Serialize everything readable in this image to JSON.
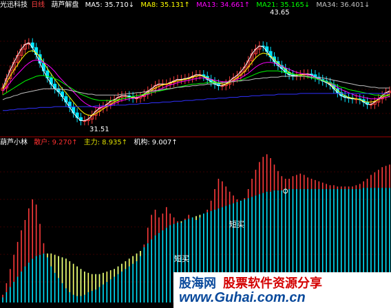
{
  "header_top": {
    "app_title": "光迅科技",
    "period": "日线",
    "indicator": "葫芦解盘",
    "ma": [
      {
        "label": "MA5:",
        "value": "35.710",
        "arrow": "↓",
        "color": "#ffffff"
      },
      {
        "label": "MA8:",
        "value": "35.131",
        "arrow": "↑",
        "color": "#ffff00"
      },
      {
        "label": "MA13:",
        "value": "34.661",
        "arrow": "↑",
        "color": "#ff00ff"
      },
      {
        "label": "MA21:",
        "value": "35.165",
        "arrow": "↓",
        "color": "#00ff00"
      },
      {
        "label": "MA34:",
        "value": "36.401",
        "arrow": "↓",
        "color": "#c0c0c0"
      }
    ]
  },
  "header_bottom": {
    "title": "葫芦小林",
    "items": [
      {
        "label": "散户:",
        "value": "9.270",
        "arrow": "↑",
        "color": "#ff3030"
      },
      {
        "label": "主力:",
        "value": "8.935",
        "arrow": "↑",
        "color": "#e0e000"
      },
      {
        "label": "机构:",
        "value": "9.007",
        "arrow": "↑",
        "color": "#ffffff"
      }
    ]
  },
  "annotations": {
    "high": "43.65",
    "low": "31.51",
    "signal_1": "短买",
    "signal_2": "短买"
  },
  "watermark": {
    "line1a": "股海网",
    "line1b": "股票软件资源分享",
    "line2": "www.Guhai.com.cn"
  },
  "colors": {
    "up": "#ff3b3b",
    "down": "#00e5ff",
    "bg": "#000000",
    "zero_cross": "#ffff66"
  },
  "chart_data": [
    {
      "type": "candlestick",
      "title": "葫芦解盘",
      "ylim": [
        30,
        46
      ],
      "annotations": [
        {
          "text": "43.65",
          "kind": "high"
        },
        {
          "text": "31.51",
          "kind": "low"
        }
      ],
      "series": [
        {
          "name": "MA5",
          "values": [
            36.1,
            37.3,
            38.4,
            39.4,
            40.3,
            41.1,
            41.7,
            41.9,
            41.3,
            40.4,
            39.3,
            38.3,
            37.4,
            36.6,
            36,
            35.6,
            35,
            34.3,
            33.6,
            32.9,
            32.3,
            31.9,
            31.9,
            32.1,
            32.6,
            33.1,
            33.5,
            33.7,
            34,
            34.4,
            34.6,
            34.9,
            35.1,
            35.1,
            35,
            34.8,
            34.8,
            35,
            35.3,
            35.7,
            36,
            36.4,
            36.6,
            36.6,
            36.6,
            36.8,
            37,
            37.2,
            37.2,
            37.3,
            37.4,
            37.6,
            37.8,
            37.8,
            37.6,
            37.2,
            36.9,
            36.6,
            36.4,
            36.4,
            36.6,
            37,
            37.4,
            37.7,
            38.2,
            38.8,
            39.6,
            40.5,
            41.1,
            41.5,
            41.4,
            40.8,
            40.1,
            39.5,
            39,
            38.6,
            38.1,
            37.8,
            37.7,
            37.7,
            37.8,
            37.9,
            37.9,
            37.8,
            37.5,
            37.2,
            37,
            36.8,
            36.5,
            36,
            35.5,
            35.1,
            34.9,
            34.8,
            34.7,
            34.7,
            34.6,
            34.3,
            34,
            34,
            34.3,
            34.7,
            35.1,
            35.5,
            35.7
          ]
        },
        {
          "name": "MA8",
          "values": [
            35.9,
            36.8,
            37.6,
            38.4,
            39.1,
            39.8,
            40.4,
            40.8,
            40.9,
            40.6,
            40.1,
            39.4,
            38.6,
            37.9,
            37.2,
            36.6,
            36,
            35.5,
            34.9,
            34.3,
            33.7,
            33.2,
            32.8,
            32.6,
            32.6,
            32.8,
            33.1,
            33.4,
            33.7,
            34,
            34.3,
            34.5,
            34.7,
            34.8,
            34.9,
            34.9,
            34.9,
            35,
            35.2,
            35.5,
            35.8,
            36.1,
            36.3,
            36.5,
            36.6,
            36.7,
            36.9,
            37,
            37.1,
            37.2,
            37.3,
            37.5,
            37.6,
            37.7,
            37.6,
            37.4,
            37.2,
            36.9,
            36.7,
            36.6,
            36.6,
            36.8,
            37.1,
            37.4,
            37.8,
            38.2,
            38.8,
            39.4,
            40,
            40.4,
            40.6,
            40.5,
            40.2,
            39.8,
            39.3,
            38.9,
            38.5,
            38.1,
            37.9,
            37.8,
            37.8,
            37.8,
            37.8,
            37.7,
            37.5,
            37.3,
            37.1,
            36.9,
            36.6,
            36.2,
            35.8,
            35.4,
            35.1,
            34.9,
            34.8,
            34.7,
            34.6,
            34.4,
            34.3,
            34.3,
            34.4,
            34.6,
            34.9,
            35.1,
            35.3
          ]
        },
        {
          "name": "MA13",
          "values": [
            35.7,
            36.2,
            36.8,
            37.4,
            37.9,
            38.4,
            38.9,
            39.3,
            39.6,
            39.7,
            39.6,
            39.4,
            39.1,
            38.7,
            38.2,
            37.6,
            37.1,
            36.6,
            36.1,
            35.6,
            35.1,
            34.6,
            34.2,
            33.9,
            33.7,
            33.6,
            33.6,
            33.7,
            33.8,
            33.9,
            34.1,
            34.3,
            34.5,
            34.6,
            34.7,
            34.8,
            34.9,
            35,
            35.1,
            35.3,
            35.5,
            35.7,
            35.9,
            36.1,
            36.3,
            36.5,
            36.6,
            36.8,
            36.9,
            37,
            37.1,
            37.2,
            37.3,
            37.4,
            37.4,
            37.3,
            37.2,
            37.1,
            37,
            36.9,
            36.9,
            36.9,
            37,
            37.2,
            37.4,
            37.7,
            38,
            38.4,
            38.8,
            39.1,
            39.3,
            39.4,
            39.4,
            39.3,
            39.1,
            38.9,
            38.7,
            38.5,
            38.3,
            38.1,
            38,
            37.9,
            37.8,
            37.7,
            37.5,
            37.3,
            37.1,
            36.9,
            36.7,
            36.5,
            36.2,
            35.9,
            35.7,
            35.5,
            35.3,
            35.1,
            35,
            34.9,
            34.8,
            34.7,
            34.7,
            34.7,
            34.8,
            34.9,
            35
          ]
        },
        {
          "name": "MA21",
          "values": [
            35.2,
            35.5,
            35.8,
            36.1,
            36.4,
            36.7,
            37,
            37.2,
            37.4,
            37.6,
            37.7,
            37.7,
            37.6,
            37.5,
            37.3,
            37.1,
            36.8,
            36.5,
            36.2,
            35.9,
            35.6,
            35.3,
            35.1,
            34.9,
            34.7,
            34.6,
            34.5,
            34.5,
            34.5,
            34.5,
            34.5,
            34.6,
            34.7,
            34.8,
            34.9,
            35,
            35.1,
            35.2,
            35.3,
            35.4,
            35.5,
            35.6,
            35.7,
            35.8,
            35.9,
            36,
            36.1,
            36.2,
            36.3,
            36.4,
            36.5,
            36.6,
            36.6,
            36.7,
            36.7,
            36.8,
            36.8,
            36.8,
            36.8,
            36.8,
            36.8,
            36.9,
            36.9,
            37,
            37.1,
            37.3,
            37.5,
            37.7,
            37.9,
            38.1,
            38.2,
            38.3,
            38.3,
            38.3,
            38.3,
            38.2,
            38.1,
            38,
            37.9,
            37.8,
            37.7,
            37.6,
            37.5,
            37.4,
            37.3,
            37.2,
            37.1,
            36.9,
            36.8,
            36.6,
            36.4,
            36.2,
            36.1,
            35.9,
            35.8,
            35.7,
            35.6,
            35.5,
            35.4,
            35.3,
            35.2,
            35.2,
            35.1,
            35.1,
            35.1
          ]
        },
        {
          "name": "MA34",
          "values": [
            34.6,
            34.8,
            34.9,
            35.1,
            35.2,
            35.4,
            35.5,
            35.6,
            35.7,
            35.8,
            35.9,
            36,
            36,
            36,
            36,
            36,
            35.9,
            35.9,
            35.8,
            35.7,
            35.6,
            35.5,
            35.4,
            35.3,
            35.3,
            35.2,
            35.2,
            35.2,
            35.2,
            35.2,
            35.2,
            35.2,
            35.3,
            35.3,
            35.4,
            35.4,
            35.5,
            35.5,
            35.6,
            35.6,
            35.7,
            35.8,
            35.8,
            35.9,
            36,
            36,
            36.1,
            36.2,
            36.2,
            36.3,
            36.3,
            36.4,
            36.4,
            36.5,
            36.5,
            36.6,
            36.6,
            36.7,
            36.7,
            36.8,
            36.8,
            36.9,
            36.9,
            37,
            37,
            37.1,
            37.1,
            37.2,
            37.3,
            37.3,
            37.4,
            37.4,
            37.5,
            37.5,
            37.5,
            37.6,
            37.6,
            37.6,
            37.6,
            37.6,
            37.6,
            37.6,
            37.6,
            37.5,
            37.5,
            37.4,
            37.4,
            37.3,
            37.2,
            37.1,
            37,
            36.9,
            36.8,
            36.7,
            36.6,
            36.5,
            36.4,
            36.4,
            36.3,
            36.2,
            36.2,
            36.1,
            36.1,
            36.1,
            36.1
          ]
        },
        {
          "name": "MA60",
          "values": [
            33.2,
            33.2,
            33.3,
            33.3,
            33.4,
            33.4,
            33.4,
            33.5,
            33.5,
            33.5,
            33.6,
            33.6,
            33.6,
            33.6,
            33.7,
            33.7,
            33.7,
            33.7,
            33.7,
            33.7,
            33.7,
            33.7,
            33.7,
            33.7,
            33.7,
            33.8,
            33.8,
            33.8,
            33.8,
            33.8,
            33.9,
            33.9,
            33.9,
            33.9,
            34,
            34,
            34,
            34.1,
            34.1,
            34.1,
            34.2,
            34.2,
            34.2,
            34.3,
            34.3,
            34.3,
            34.4,
            34.4,
            34.4,
            34.5,
            34.5,
            34.5,
            34.6,
            34.6,
            34.6,
            34.7,
            34.7,
            34.7,
            34.8,
            34.8,
            34.8,
            34.9,
            34.9,
            34.9,
            35,
            35,
            35,
            35.1,
            35.1,
            35.1,
            35.2,
            35.2,
            35.2,
            35.2,
            35.3,
            35.3,
            35.3,
            35.3,
            35.3,
            35.3,
            35.4,
            35.4,
            35.4,
            35.4,
            35.4,
            35.4,
            35.4,
            35.4,
            35.4,
            35.4,
            35.4,
            35.4,
            35.4,
            35.4,
            35.4,
            35.4,
            35.4,
            35.4,
            35.4,
            35.4,
            35.4,
            35.4,
            35.4,
            35.4,
            35.4
          ]
        }
      ]
    },
    {
      "type": "bar",
      "title": "葫芦小林",
      "ylim": [
        0,
        12
      ],
      "annotations": [
        {
          "text": "短买",
          "index": 39
        },
        {
          "text": "短买",
          "index": 84
        }
      ],
      "series": [
        {
          "name": "散户",
          "values": [
            0.6,
            1.5,
            2.6,
            3.7,
            4.7,
            5.6,
            6.4,
            7.3,
            8,
            7.6,
            6.1,
            4.6,
            3.5,
            2.8,
            2.3,
            1.9,
            1.5,
            1.1,
            0.8,
            0.6,
            0.5,
            0.5,
            0.6,
            0.8,
            0.9,
            1,
            1.2,
            1.4,
            1.6,
            1.8,
            2,
            2.2,
            2.4,
            2.6,
            2.8,
            3,
            3.2,
            3.6,
            4.5,
            5.8,
            6.8,
            7.2,
            6.6,
            6.9,
            7.4,
            6.9,
            6.6,
            6.3,
            6.2,
            6.5,
            6.8,
            6.6,
            6.4,
            6.6,
            6.9,
            7.2,
            7.9,
            8.8,
            9.6,
            9.4,
            9,
            8.6,
            8.3,
            8,
            7.9,
            8.1,
            8.8,
            9.6,
            10.3,
            10.9,
            11.3,
            11.5,
            11.2,
            10.7,
            10.2,
            9.8,
            9.6,
            9.6,
            9.8,
            9.9,
            10,
            9.9,
            9.7,
            9.6,
            9.5,
            9.4,
            9.3,
            9.2,
            9.1,
            9.1,
            9,
            9,
            9,
            9,
            9,
            9.1,
            9.2,
            9.4,
            9.6,
            9.9,
            10.1,
            10.3,
            10.5,
            10.6,
            10.7
          ]
        },
        {
          "name": "主力",
          "values": [
            0.4,
            0.8,
            1.2,
            1.6,
            2,
            2.4,
            2.8,
            3.1,
            3.4,
            3.6,
            3.7,
            3.8,
            3.8,
            3.8,
            3.7,
            3.6,
            3.5,
            3.4,
            3.2,
            3,
            2.8,
            2.6,
            2.4,
            2.3,
            2.2,
            2.2,
            2.2,
            2.3,
            2.4,
            2.5,
            2.6,
            2.8,
            3,
            3.2,
            3.4,
            3.6,
            3.8,
            4,
            4.3,
            4.6,
            4.9,
            5.2,
            5.4,
            5.6,
            5.8,
            6,
            6.1,
            6.2,
            6.3,
            6.4,
            6.5,
            6.6,
            6.7,
            6.8,
            6.9,
            7,
            7.1,
            7.2,
            7.3,
            7.4,
            7.5,
            7.6,
            7.7,
            7.8,
            7.9,
            8,
            8.1,
            8.2,
            8.3,
            8.4,
            8.5,
            8.6,
            8.6,
            8.7,
            8.7,
            8.7,
            8.8,
            8.8,
            8.8,
            8.8,
            8.8,
            8.8,
            8.8,
            8.8,
            8.8,
            8.8,
            8.8,
            8.8,
            8.8,
            8.8,
            8.8,
            8.8,
            8.8,
            8.8,
            8.8,
            8.8,
            8.8,
            8.9,
            8.9,
            8.9,
            8.9,
            8.9,
            8.9,
            8.9,
            8.9
          ]
        }
      ]
    }
  ]
}
